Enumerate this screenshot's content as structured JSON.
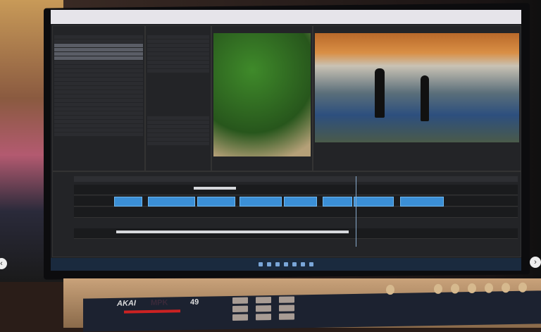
{
  "keyboard": {
    "brand": "AKAI",
    "series": "MPK",
    "model": "49"
  },
  "nav": {
    "prev": "‹",
    "next": "›"
  },
  "colors": {
    "clip": "#3b8fd6",
    "ui_bg": "#1e1f22",
    "taskbar": "#1a2a3e"
  }
}
